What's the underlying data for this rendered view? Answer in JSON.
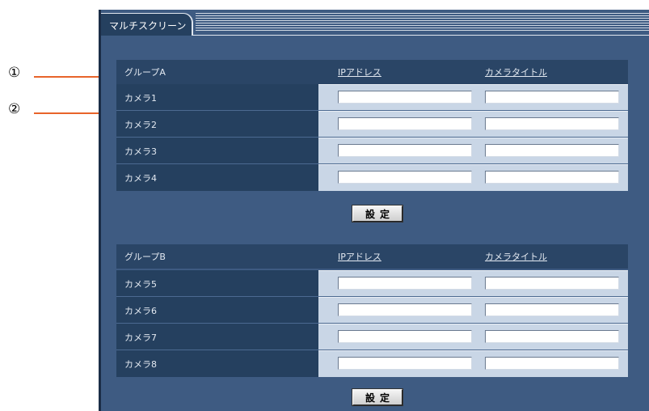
{
  "tab": {
    "label": "マルチスクリーン"
  },
  "groups": [
    {
      "header": {
        "group": "グループA",
        "ip": "IPアドレス",
        "title": "カメラタイトル"
      },
      "rows": [
        {
          "label": "カメラ1",
          "ip": "",
          "title": ""
        },
        {
          "label": "カメラ2",
          "ip": "",
          "title": ""
        },
        {
          "label": "カメラ3",
          "ip": "",
          "title": ""
        },
        {
          "label": "カメラ4",
          "ip": "",
          "title": ""
        }
      ],
      "button": "設定"
    },
    {
      "header": {
        "group": "グループB",
        "ip": "IPアドレス",
        "title": "カメラタイトル"
      },
      "rows": [
        {
          "label": "カメラ5",
          "ip": "",
          "title": ""
        },
        {
          "label": "カメラ6",
          "ip": "",
          "title": ""
        },
        {
          "label": "カメラ7",
          "ip": "",
          "title": ""
        },
        {
          "label": "カメラ8",
          "ip": "",
          "title": ""
        }
      ],
      "button": "設定"
    }
  ],
  "callouts": [
    "①",
    "②"
  ],
  "colors": {
    "panel": "#3e5b82",
    "label_bg": "#25405f",
    "field_bg": "#c9d6e6",
    "callout_line": "#e8642a"
  }
}
